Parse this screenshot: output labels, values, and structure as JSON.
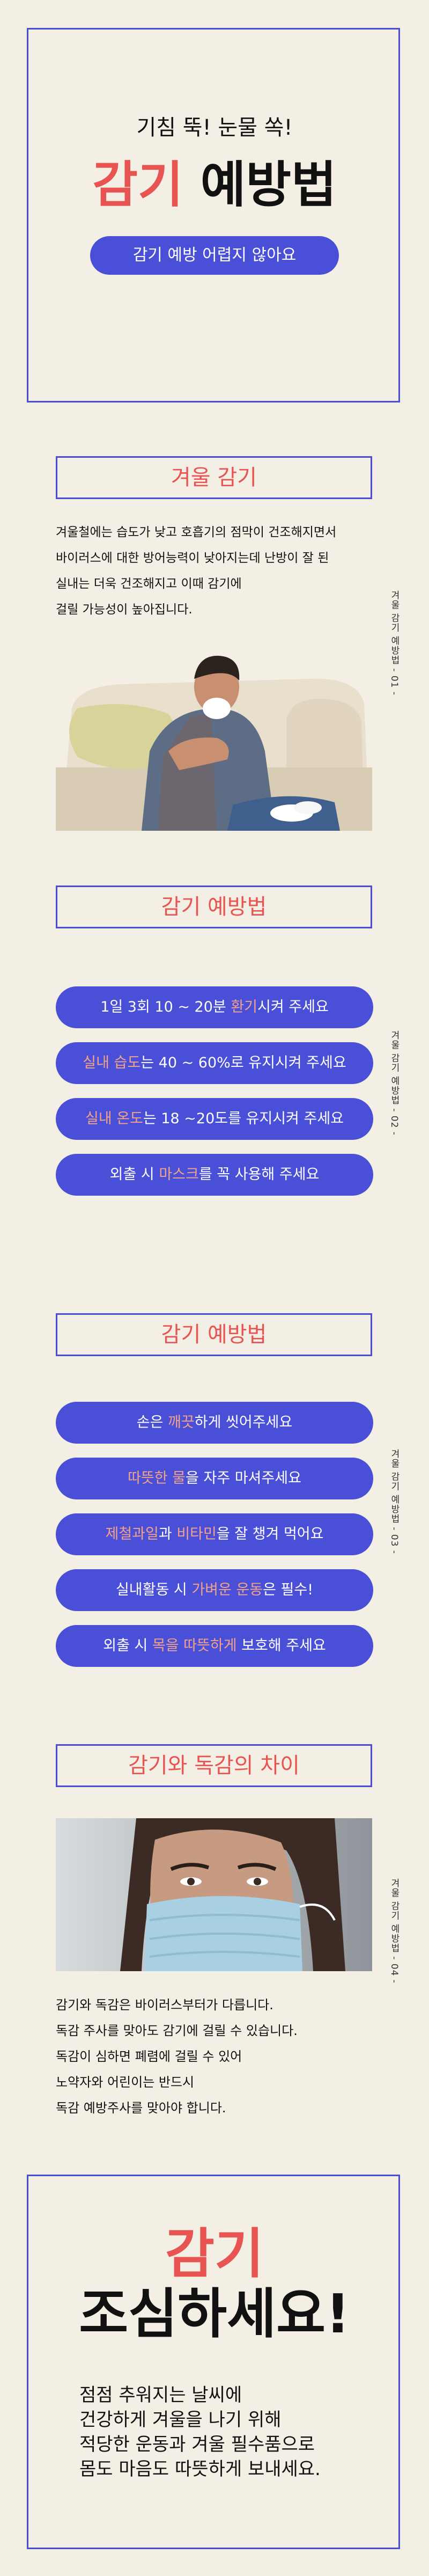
{
  "hero": {
    "subtitle": "기침 뚝! 눈물 쏙!",
    "title_red": "감기",
    "title_black": "예방법",
    "pill": "감기 예방 어렵지 않아요"
  },
  "section1": {
    "heading": "겨울 감기",
    "lines": [
      "겨울철에는 습도가 낮고 호흡기의 점막이 건조해지면서",
      "바이러스에 대한 방어능력이 낮아지는데 난방이 잘 된",
      "실내는 더욱 건조해지고 이때 감기에",
      "걸릴 가능성이 높아집니다."
    ],
    "side": "겨울 감기 예방법 - 01 -"
  },
  "section2": {
    "heading": "감기 예방법",
    "side": "겨울 감기 예방법 - 02 -",
    "pills": [
      {
        "pre": "1일 3회 10 ~ 20분 ",
        "hl": "환기",
        "post": "시켜 주세요"
      },
      {
        "pre": "",
        "hl": "실내 습도",
        "post": "는 40 ~ 60%로 유지시켜 주세요"
      },
      {
        "pre": "",
        "hl": "실내 온도",
        "post": "는 18 ~20도를 유지시켜 주세요"
      },
      {
        "pre": "외출 시 ",
        "hl": "마스크",
        "post": "를 꼭 사용해 주세요"
      }
    ]
  },
  "section3": {
    "heading": "감기 예방법",
    "side": "겨울 감기 예방법 - 03 -",
    "pills": [
      {
        "pre": "손은 ",
        "hl": "깨끗",
        "post": "하게 씻어주세요"
      },
      {
        "pre": "",
        "hl": "따뜻한 물",
        "post": "을 자주 마셔주세요"
      },
      {
        "pre": "",
        "hl": "제철과일",
        "post": "과 ",
        "hl2": "비타민",
        "post2": "을 잘 챙겨 먹어요"
      },
      {
        "pre": "실내활동 시 ",
        "hl": "가벼운 운동",
        "post": "은 필수!"
      },
      {
        "pre": "외출 시 ",
        "hl": "목을 따뜻하게",
        "post": " 보호해 주세요"
      }
    ]
  },
  "section4": {
    "heading": "감기와 독감의 차이",
    "side": "겨울 감기 예방법 - 04 -",
    "lines": [
      "감기와 독감은 바이러스부터가 다릅니다.",
      "독감 주사를 맞아도 감기에 걸릴 수 있습니다.",
      "독감이 심하면 폐렴에 걸릴 수 있어",
      "노약자와 어린이는 반드시",
      "독감 예방주사를 맞아야 합니다."
    ]
  },
  "ending": {
    "title1": "감기",
    "title2": "조심하세요!",
    "lines": [
      "점점 추워지는 날씨에",
      "건강하게 겨울을 나기 위해",
      "적당한 운동과 겨울 필수품으로",
      "몸도 마음도 따뜻하게 보내세요."
    ]
  },
  "colors": {
    "background": "#f3efe5",
    "accent_blue": "#4a4fd8",
    "accent_red": "#e85452",
    "highlight": "#f3a28a"
  }
}
